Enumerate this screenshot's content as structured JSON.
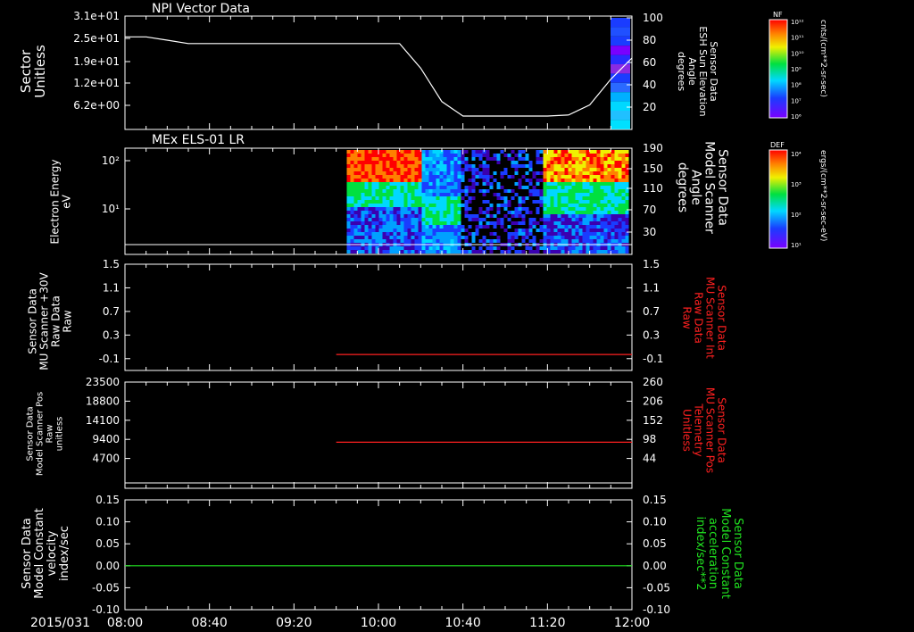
{
  "chart_data": [
    {
      "type": "line",
      "title": "NPI Vector Data",
      "ylabel_left": [
        "Sector",
        "Unitless"
      ],
      "ylabel_right": [
        "Sensor Data",
        "ESH Sun Elevation",
        "Angle",
        "degrees"
      ],
      "yticks_left": [
        "3.1e+01",
        "2.5e+01",
        "1.9e+01",
        "1.2e+01",
        "6.2e+00"
      ],
      "yticks_right": [
        "100",
        "80",
        "60",
        "40",
        "20"
      ],
      "ylim_right": [
        0,
        100
      ],
      "line_color": "#ffffff",
      "series": [
        {
          "x": [
            "08:00",
            "08:10",
            "08:20",
            "08:30",
            "09:00",
            "09:40",
            "10:00",
            "10:10",
            "10:20",
            "10:30",
            "10:40",
            "11:00",
            "11:20",
            "11:30",
            "11:40",
            "11:50",
            "12:00"
          ],
          "y": [
            83,
            83,
            80,
            77,
            77,
            77,
            77,
            77,
            55,
            25,
            12,
            12,
            12,
            13,
            22,
            45,
            64
          ]
        }
      ],
      "colorbar": {
        "label": "NF",
        "units": "cnts/(cm**2-sr-sec)",
        "ticks": [
          "10¹²",
          "10¹¹",
          "10¹⁰",
          "10⁹",
          "10⁸",
          "10⁷",
          "10⁶"
        ]
      }
    },
    {
      "type": "heatmap",
      "title": "MEx ELS-01 LR",
      "ylabel_left": [
        "Electron Energy",
        "eV"
      ],
      "ylabel_right": [
        "Sensor Data",
        "Model Scanner",
        "Angle",
        "degrees"
      ],
      "yticks_left": [
        "10²",
        "10¹"
      ],
      "yticks_right": [
        "190",
        "150",
        "110",
        "70",
        "30"
      ],
      "data_start": "09:45",
      "colorbar": {
        "label": "DEF",
        "units": "ergs/(cm**2-sr-sec-eV)",
        "ticks": [
          "10⁴",
          "10³",
          "10²",
          "10¹"
        ]
      }
    },
    {
      "type": "line",
      "ylabel_left": [
        "Sensor Data",
        "MU Scanner +30V",
        "Raw Data",
        "Raw"
      ],
      "ylabel_right": [
        "Sensor Data",
        "MU Scanner Int",
        "Raw Data",
        "Raw"
      ],
      "yticks": [
        "1.5",
        "1.1",
        "0.7",
        "0.3",
        "-0.1"
      ],
      "ylim": [
        -0.3,
        1.5
      ],
      "line_color": "#ff2020",
      "series": [
        {
          "x": [
            "09:40",
            "12:00"
          ],
          "y": [
            -0.03,
            -0.03
          ]
        }
      ]
    },
    {
      "type": "line",
      "ylabel_left": [
        "Sensor Data",
        "Model Scanner Pos",
        "Raw",
        "unitless"
      ],
      "ylabel_right": [
        "Sensor Data",
        "MU Scanner Pos",
        "Telemetry",
        "Unitless"
      ],
      "yticks_left": [
        "23500",
        "18800",
        "14100",
        "9400",
        "4700"
      ],
      "yticks_right": [
        "260",
        "206",
        "152",
        "98",
        "44"
      ],
      "ylim_left": [
        0,
        23500
      ],
      "line_color": "#ff2020",
      "series": [
        {
          "x": [
            "09:40",
            "12:00"
          ],
          "y": [
            8700,
            8700
          ]
        }
      ]
    },
    {
      "type": "line",
      "ylabel_left": [
        "Sensor Data",
        "Model Constant",
        "velocity",
        "index/sec"
      ],
      "ylabel_right": [
        "Sensor Data",
        "Model Constant",
        "acceleration",
        "index/sec**2"
      ],
      "yticks": [
        "0.15",
        "0.10",
        "0.05",
        "0.00",
        "-0.05",
        "-0.10"
      ],
      "ylim": [
        -0.1,
        0.15
      ],
      "line_color": "#20e020",
      "series": [
        {
          "x": [
            "08:00",
            "12:00"
          ],
          "y": [
            0.0,
            0.0
          ]
        }
      ]
    }
  ],
  "xaxis": {
    "date": "2015/031",
    "ticks": [
      "08:00",
      "08:40",
      "09:20",
      "10:00",
      "10:40",
      "11:20",
      "12:00"
    ]
  }
}
